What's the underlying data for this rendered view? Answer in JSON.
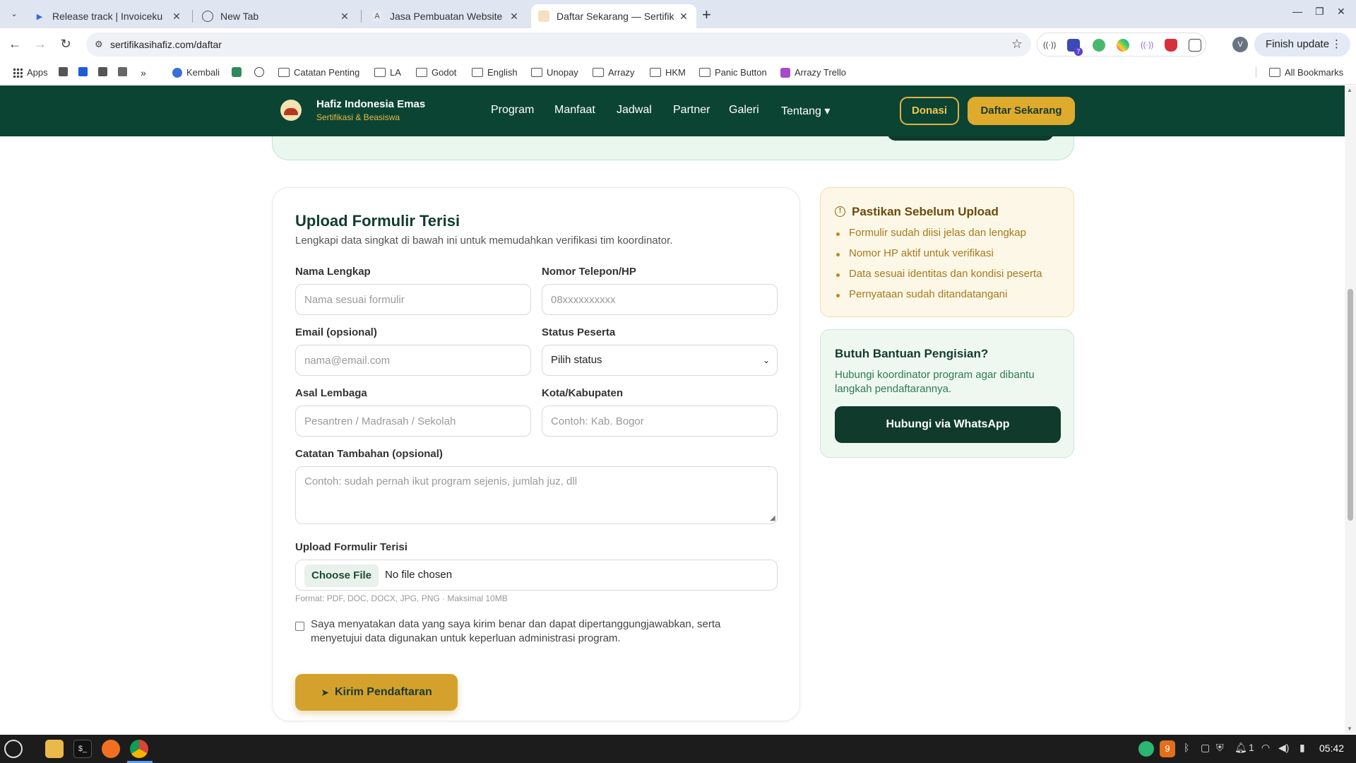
{
  "browser": {
    "tabs": [
      {
        "title": "Release track | Invoiceku"
      },
      {
        "title": "New Tab"
      },
      {
        "title": "Jasa Pembuatan Website Pe"
      },
      {
        "title": "Daftar Sekarang — Sertifika"
      }
    ],
    "url": "sertifikasihafiz.com/daftar",
    "finish_update": "Finish update",
    "profile_initial": "V",
    "ext_badge": "7",
    "bookmarks": [
      "Apps",
      "Kembali",
      "Catatan Penting",
      "LA",
      "Godot",
      "English",
      "Unopay",
      "Arrazy",
      "HKM",
      "Panic Button",
      "Arrazy Trello"
    ],
    "all_bookmarks": "All Bookmarks"
  },
  "site": {
    "brand_name": "Hafiz Indonesia Emas",
    "brand_sub": "Sertifikasi & Beasiswa",
    "menu": [
      "Program",
      "Manfaat",
      "Jadwal",
      "Partner",
      "Galeri",
      "Tentang ▾"
    ],
    "donasi": "Donasi",
    "daftar": "Daftar Sekarang"
  },
  "form": {
    "title": "Upload Formulir Terisi",
    "subtitle": "Lengkapi data singkat di bawah ini untuk memudahkan verifikasi tim koordinator.",
    "name_label": "Nama Lengkap",
    "name_placeholder": "Nama sesuai formulir",
    "phone_label": "Nomor Telepon/HP",
    "phone_placeholder": "08xxxxxxxxxx",
    "email_label": "Email (opsional)",
    "email_placeholder": "nama@email.com",
    "status_label": "Status Peserta",
    "status_value": "Pilih status",
    "lembaga_label": "Asal Lembaga",
    "lembaga_placeholder": "Pesantren / Madrasah / Sekolah",
    "kota_label": "Kota/Kabupaten",
    "kota_placeholder": "Contoh: Kab. Bogor",
    "notes_label": "Catatan Tambahan (opsional)",
    "notes_placeholder": "Contoh: sudah pernah ikut program sejenis, jumlah juz, dll",
    "upload_label": "Upload Formulir Terisi",
    "choose_file": "Choose File",
    "no_file": "No file chosen",
    "format_hint": "Format: PDF, DOC, DOCX, JPG, PNG · Maksimal 10MB",
    "consent_line1": "Saya menyatakan data yang saya kirim benar dan dapat dipertanggungjawabkan, serta",
    "consent_line2": "menyetujui data digunakan untuk keperluan administrasi program.",
    "submit": "Kirim Pendaftaran"
  },
  "checklist": {
    "title": "Pastikan Sebelum Upload",
    "items": [
      "Formulir sudah diisi jelas dan lengkap",
      "Nomor HP aktif untuk verifikasi",
      "Data sesuai identitas dan kondisi peserta",
      "Pernyataan sudah ditandatangani"
    ]
  },
  "help": {
    "title": "Butuh Bantuan Pengisian?",
    "text": "Hubungi koordinator program agar dibantu langkah pendaftarannya.",
    "button": "Hubungi via WhatsApp"
  },
  "taskbar": {
    "clock": "05:42",
    "badge": "9",
    "notif_count": "1"
  },
  "colors": {
    "header_bg": "#0c4434",
    "gold": "#dfab2d",
    "dark_green": "#0f3a2c"
  }
}
